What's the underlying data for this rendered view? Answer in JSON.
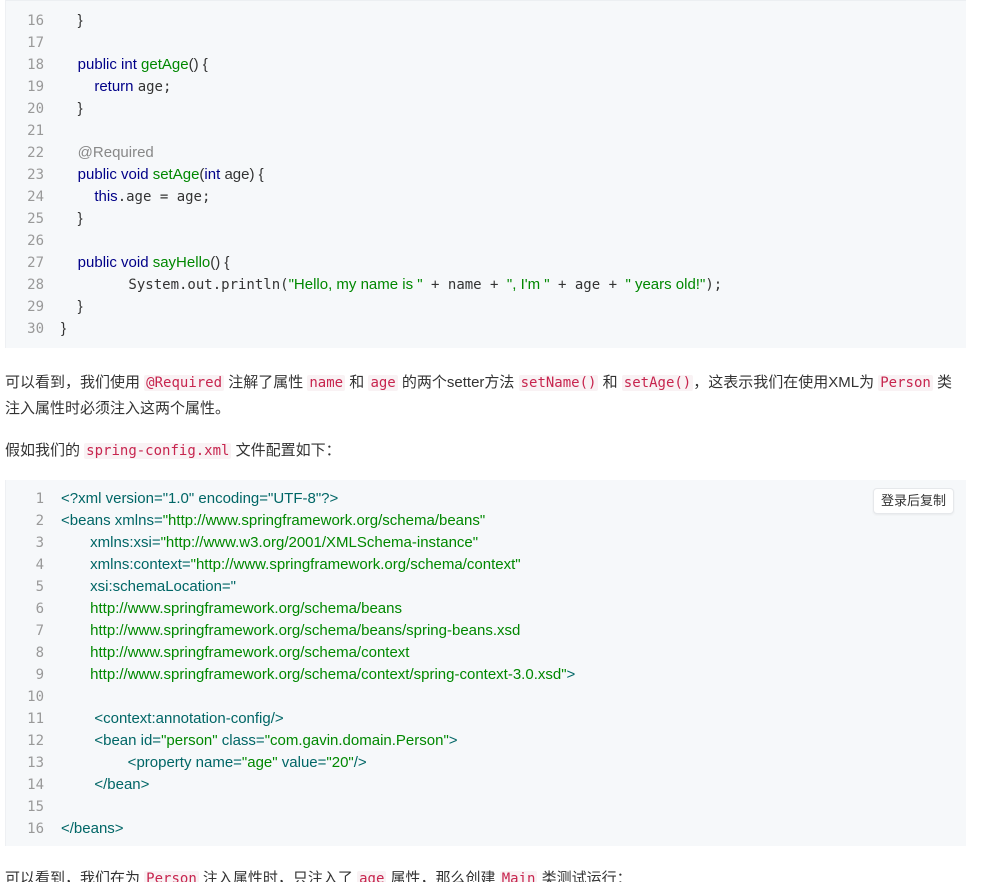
{
  "code_block_1": {
    "lines": [
      {
        "n": "16",
        "tokens": [
          {
            "t": "    }",
            "c": "plain"
          }
        ]
      },
      {
        "n": "17",
        "tokens": []
      },
      {
        "n": "18",
        "tokens": [
          {
            "t": "    public int ",
            "c": "kw"
          },
          {
            "t": "getAge",
            "c": "fn"
          },
          {
            "t": "() {",
            "c": "plain"
          }
        ]
      },
      {
        "n": "19",
        "tokens": [
          {
            "t": "        return ",
            "c": "kw"
          },
          {
            "t": "age;",
            "c": "plain",
            "mono": true
          }
        ]
      },
      {
        "n": "20",
        "tokens": [
          {
            "t": "    }",
            "c": "plain"
          }
        ]
      },
      {
        "n": "21",
        "tokens": []
      },
      {
        "n": "22",
        "tokens": [
          {
            "t": "    @Required",
            "c": "ann"
          }
        ]
      },
      {
        "n": "23",
        "tokens": [
          {
            "t": "    public void ",
            "c": "kw"
          },
          {
            "t": "setAge",
            "c": "fn"
          },
          {
            "t": "(",
            "c": "plain"
          },
          {
            "t": "int ",
            "c": "kw"
          },
          {
            "t": "age) {",
            "c": "plain"
          }
        ]
      },
      {
        "n": "24",
        "tokens": [
          {
            "t": "        this",
            "c": "kw"
          },
          {
            "t": ".age = age;",
            "c": "plain",
            "mono": true
          }
        ]
      },
      {
        "n": "25",
        "tokens": [
          {
            "t": "    }",
            "c": "plain"
          }
        ]
      },
      {
        "n": "26",
        "tokens": []
      },
      {
        "n": "27",
        "tokens": [
          {
            "t": "    public void ",
            "c": "kw"
          },
          {
            "t": "sayHello",
            "c": "fn"
          },
          {
            "t": "() {",
            "c": "plain"
          }
        ]
      },
      {
        "n": "28",
        "tokens": [
          {
            "t": "        System.out.println(",
            "c": "plain",
            "mono": true
          },
          {
            "t": "\"Hello, my name is \"",
            "c": "str"
          },
          {
            "t": " + name + ",
            "c": "plain",
            "mono": true
          },
          {
            "t": "\", I'm \"",
            "c": "str"
          },
          {
            "t": " + age + ",
            "c": "plain",
            "mono": true
          },
          {
            "t": "\" years old!\"",
            "c": "str"
          },
          {
            "t": ");",
            "c": "plain",
            "mono": true
          }
        ]
      },
      {
        "n": "29",
        "tokens": [
          {
            "t": "    }",
            "c": "plain"
          }
        ]
      },
      {
        "n": "30",
        "tokens": [
          {
            "t": "}",
            "c": "plain"
          }
        ]
      }
    ]
  },
  "paragraph_1": {
    "parts": [
      {
        "t": "可以看到，我们使用 "
      },
      {
        "t": "@Required",
        "code": true
      },
      {
        "t": " 注解了属性 "
      },
      {
        "t": "name",
        "code": true
      },
      {
        "t": " 和 "
      },
      {
        "t": "age",
        "code": true
      },
      {
        "t": " 的两个setter方法 "
      },
      {
        "t": "setName()",
        "code": true
      },
      {
        "t": " 和 "
      },
      {
        "t": "setAge()",
        "code": true
      },
      {
        "t": "，这表示我们在使用XML为 "
      },
      {
        "t": "Person",
        "code": true
      },
      {
        "t": " 类注入属性时必须注入这两个属性。"
      }
    ]
  },
  "paragraph_2": {
    "parts": [
      {
        "t": "假如我们的 "
      },
      {
        "t": "spring-config.xml",
        "code": true
      },
      {
        "t": " 文件配置如下："
      }
    ]
  },
  "code_block_2": {
    "copy_button": "登录后复制",
    "lines": [
      {
        "n": "1",
        "tokens": [
          {
            "t": "<?xml version=\"1.0\" encoding=\"UTF-8\"?>",
            "c": "tag"
          }
        ]
      },
      {
        "n": "2",
        "tokens": [
          {
            "t": "<beans xmlns=",
            "c": "tag"
          },
          {
            "t": "\"http://www.springframework.org/schema/beans\"",
            "c": "str"
          }
        ]
      },
      {
        "n": "3",
        "tokens": [
          {
            "t": "       xmlns:xsi=",
            "c": "tag"
          },
          {
            "t": "\"http://www.w3.org/2001/XMLSchema-instance\"",
            "c": "str"
          }
        ]
      },
      {
        "n": "4",
        "tokens": [
          {
            "t": "       xmlns:context=",
            "c": "tag"
          },
          {
            "t": "\"http://www.springframework.org/schema/context\"",
            "c": "str"
          }
        ]
      },
      {
        "n": "5",
        "tokens": [
          {
            "t": "       xsi:schemaLocation=\"",
            "c": "tag"
          }
        ]
      },
      {
        "n": "6",
        "tokens": [
          {
            "t": "       http://www.springframework.org/schema/beans",
            "c": "str"
          }
        ]
      },
      {
        "n": "7",
        "tokens": [
          {
            "t": "       http://www.springframework.org/schema/beans/spring-beans.xsd",
            "c": "str"
          }
        ]
      },
      {
        "n": "8",
        "tokens": [
          {
            "t": "       http://www.springframework.org/schema/context",
            "c": "str"
          }
        ]
      },
      {
        "n": "9",
        "tokens": [
          {
            "t": "       http://www.springframework.org/schema/context/spring-context-3.0.xsd\"",
            "c": "str"
          },
          {
            "t": ">",
            "c": "tag"
          }
        ]
      },
      {
        "n": "10",
        "tokens": []
      },
      {
        "n": "11",
        "tokens": [
          {
            "t": "        <context:annotation-config/>",
            "c": "tag"
          }
        ]
      },
      {
        "n": "12",
        "tokens": [
          {
            "t": "        <bean id=",
            "c": "tag"
          },
          {
            "t": "\"person\"",
            "c": "str"
          },
          {
            "t": " class=",
            "c": "tag"
          },
          {
            "t": "\"com.gavin.domain.Person\"",
            "c": "str"
          },
          {
            "t": ">",
            "c": "tag"
          }
        ]
      },
      {
        "n": "13",
        "tokens": [
          {
            "t": "                <property name=",
            "c": "tag"
          },
          {
            "t": "\"age\"",
            "c": "str"
          },
          {
            "t": " value=",
            "c": "tag"
          },
          {
            "t": "\"20\"",
            "c": "str"
          },
          {
            "t": "/>",
            "c": "tag"
          }
        ]
      },
      {
        "n": "14",
        "tokens": [
          {
            "t": "        </bean>",
            "c": "tag"
          }
        ]
      },
      {
        "n": "15",
        "tokens": []
      },
      {
        "n": "16",
        "tokens": [
          {
            "t": "</beans>",
            "c": "tag"
          }
        ]
      }
    ]
  },
  "paragraph_3": {
    "parts": [
      {
        "t": "可以看到，我们在为 "
      },
      {
        "t": "Person",
        "code": true
      },
      {
        "t": " 注入属性时，只注入了 "
      },
      {
        "t": "age",
        "code": true
      },
      {
        "t": " 属性，那么创建 "
      },
      {
        "t": "Main",
        "code": true
      },
      {
        "t": " 类测试运行："
      }
    ]
  }
}
